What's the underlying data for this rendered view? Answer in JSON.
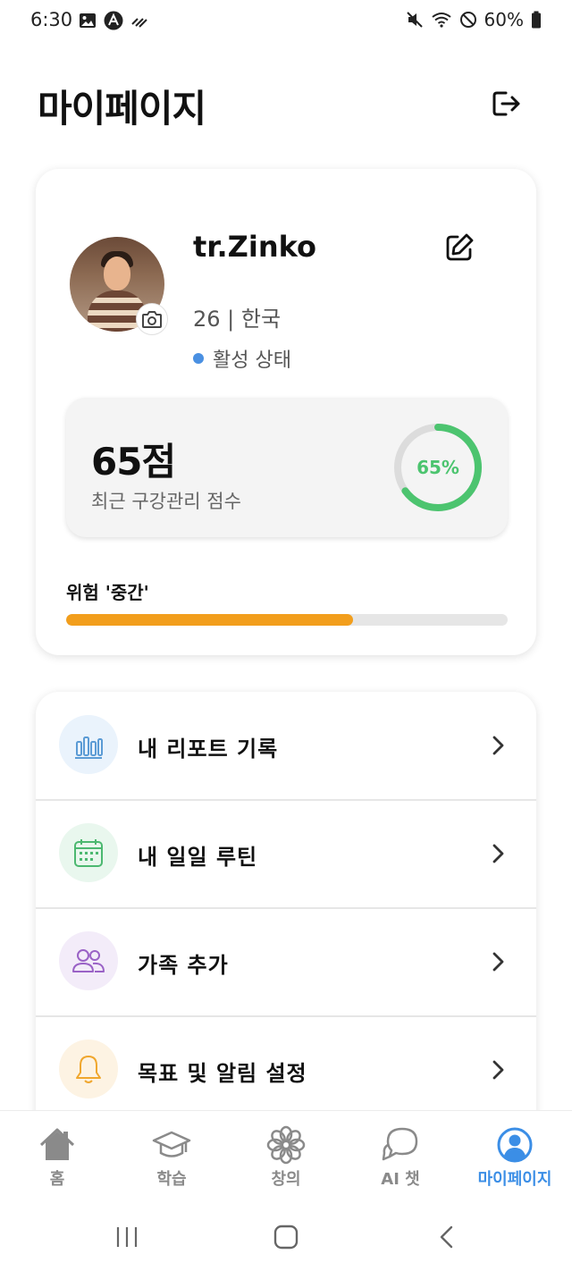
{
  "status_bar": {
    "time": "6:30",
    "battery": "60%",
    "left_icons": [
      "image-icon",
      "app-a-icon",
      "signal-slash-icon"
    ],
    "right_icons": [
      "mute-icon",
      "wifi-icon",
      "dnd-icon",
      "battery-icon"
    ]
  },
  "header": {
    "title": "마이페이지",
    "logout_icon": "logout-icon"
  },
  "profile": {
    "name": "tr.Zinko",
    "meta": "26 | 한국",
    "status": "활성 상태",
    "status_color": "#4a90e2",
    "edit_icon": "edit-icon",
    "camera_icon": "camera-icon"
  },
  "score": {
    "value": "65점",
    "label": "최근 구강관리 점수",
    "percent_text": "65%",
    "percent": 65,
    "ring_color": "#4cc46f"
  },
  "risk": {
    "label": "위험 '중간'",
    "level_percent": 65,
    "bar_color": "#f29e1c"
  },
  "menu": [
    {
      "label": "내 리포트 기록",
      "icon": "bar-chart-icon",
      "icon_color": "#5b9bd5",
      "bg": "#eaf3fc"
    },
    {
      "label": "내 일일 루틴",
      "icon": "calendar-icon",
      "icon_color": "#4cb870",
      "bg": "#e9f7ee"
    },
    {
      "label": "가족 추가",
      "icon": "people-icon",
      "icon_color": "#9a62c6",
      "bg": "#f3ecf9"
    },
    {
      "label": "목표 및 알림 설정",
      "icon": "bell-icon",
      "icon_color": "#f0a72e",
      "bg": "#fdf3e3"
    }
  ],
  "bottom_nav": [
    {
      "label": "홈",
      "icon": "home-icon",
      "active": false
    },
    {
      "label": "학습",
      "icon": "graduation-cap-icon",
      "active": false
    },
    {
      "label": "창의",
      "icon": "flower-icon",
      "active": false
    },
    {
      "label": "AI 챗",
      "icon": "chat-bubble-icon",
      "active": false
    },
    {
      "label": "마이페이지",
      "icon": "profile-icon",
      "active": true
    }
  ],
  "accent_color": "#3b8ee6"
}
